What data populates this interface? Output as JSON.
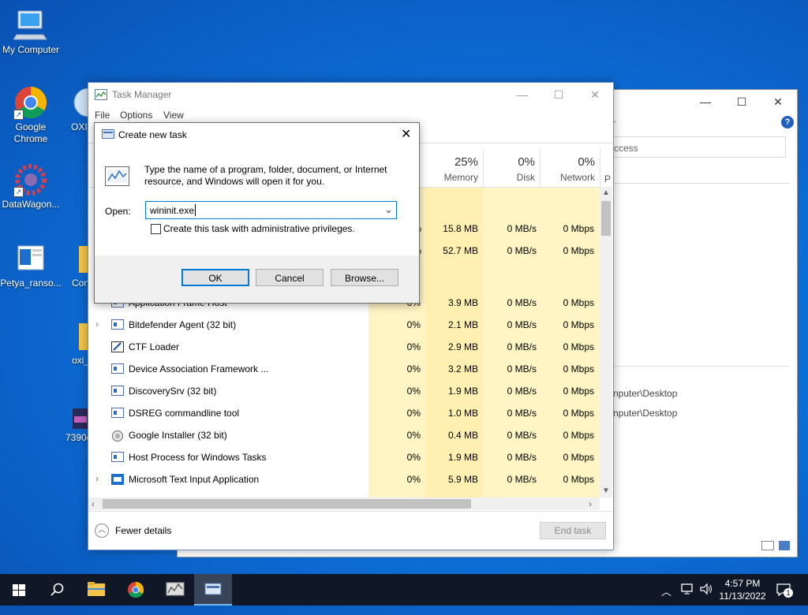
{
  "desktop": {
    "icons": [
      {
        "label": "My Computer"
      },
      {
        "label": "Google Chrome"
      },
      {
        "label": "OXI_"
      },
      {
        "label": "DataWagon..."
      },
      {
        "label": "Petya_ranso..."
      },
      {
        "label": "Con"
      },
      {
        "label": "oxi_"
      },
      {
        "label": "7390c"
      }
    ]
  },
  "background_window": {
    "search_text": "ccess",
    "path1": "nputer\\Desktop",
    "path2": "nputer\\Desktop"
  },
  "task_manager": {
    "title": "Task Manager",
    "menu": [
      "File",
      "Options",
      "View"
    ],
    "columns": {
      "memory": {
        "pct": "25%",
        "name": "Memory"
      },
      "disk": {
        "pct": "0%",
        "name": "Disk"
      },
      "network": {
        "pct": "0%",
        "name": "Network"
      },
      "power": {
        "name": "P"
      }
    },
    "partial_rows": [
      {
        "mem": "15.8 MB",
        "disk": "0 MB/s",
        "net": "0 Mbps"
      },
      {
        "mem": "52.7 MB",
        "disk": "0 MB/s",
        "net": "0 Mbps"
      }
    ],
    "rows": [
      {
        "name": "Application Frame Host",
        "cpu": "0%",
        "mem": "3.9 MB",
        "disk": "0 MB/s",
        "net": "0 Mbps"
      },
      {
        "name": "Bitdefender Agent (32 bit)",
        "cpu": "0%",
        "mem": "2.1 MB",
        "disk": "0 MB/s",
        "net": "0 Mbps"
      },
      {
        "name": "CTF Loader",
        "cpu": "0%",
        "mem": "2.9 MB",
        "disk": "0 MB/s",
        "net": "0 Mbps"
      },
      {
        "name": "Device Association Framework ...",
        "cpu": "0%",
        "mem": "3.2 MB",
        "disk": "0 MB/s",
        "net": "0 Mbps"
      },
      {
        "name": "DiscoverySrv (32 bit)",
        "cpu": "0%",
        "mem": "1.9 MB",
        "disk": "0 MB/s",
        "net": "0 Mbps"
      },
      {
        "name": "DSREG commandline tool",
        "cpu": "0%",
        "mem": "1.0 MB",
        "disk": "0 MB/s",
        "net": "0 Mbps"
      },
      {
        "name": "Google Installer (32 bit)",
        "cpu": "0%",
        "mem": "0.4 MB",
        "disk": "0 MB/s",
        "net": "0 Mbps"
      },
      {
        "name": "Host Process for Windows Tasks",
        "cpu": "0%",
        "mem": "1.9 MB",
        "disk": "0 MB/s",
        "net": "0 Mbps"
      },
      {
        "name": "Microsoft Text Input Application",
        "cpu": "0%",
        "mem": "5.9 MB",
        "disk": "0 MB/s",
        "net": "0 Mbps"
      }
    ],
    "fewer_details": "Fewer details",
    "end_task": "End task"
  },
  "dialog": {
    "title": "Create new task",
    "description": "Type the name of a program, folder, document, or Internet resource, and Windows will open it for you.",
    "open_label": "Open:",
    "open_value": "wininit.exe",
    "admin_label": "Create this task with administrative privileges.",
    "ok": "OK",
    "cancel": "Cancel",
    "browse": "Browse..."
  },
  "taskbar": {
    "time": "4:57 PM",
    "date": "11/13/2022",
    "notification_count": "1"
  },
  "colors": {
    "desktop": "#0d6fd8",
    "taskbar": "#101828",
    "cpu_column": "#fff4c4",
    "memory_column": "#ffefb0",
    "accent": "#0078d7"
  }
}
